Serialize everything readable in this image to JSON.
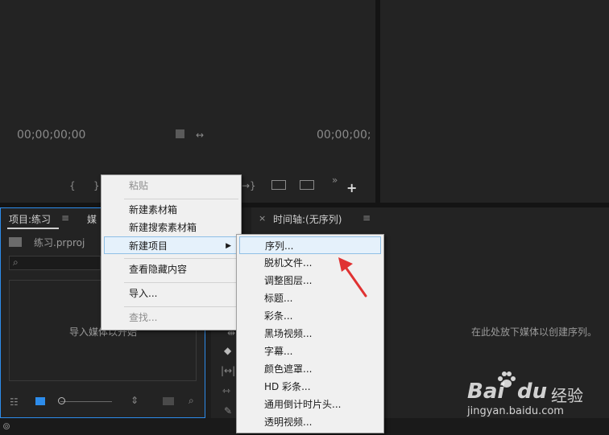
{
  "source_monitor": {
    "timecode": "00;00;00;00"
  },
  "program_monitor": {
    "timecode": "00;00;00;"
  },
  "project_panel": {
    "tab_label": "项目:练习",
    "tab2_label": "媒",
    "file_name": "练习.prproj",
    "empty_text": "导入媒体以开始"
  },
  "timeline_panel": {
    "tab_label": "时间轴:(无序列)",
    "empty_text": "在此处放下媒体以创建序列。"
  },
  "context_menu": {
    "paste": "粘贴",
    "new_bin": "新建素材箱",
    "new_search_bin": "新建搜索素材箱",
    "new_item": "新建项目",
    "view_hidden": "查看隐藏内容",
    "import": "导入...",
    "find": "查找..."
  },
  "submenu": {
    "items": [
      "序列...",
      "脱机文件...",
      "调整图层...",
      "标题...",
      "彩条...",
      "黑场视频...",
      "字幕...",
      "颜色遮罩...",
      "HD 彩条...",
      "通用倒计时片头...",
      "透明视频..."
    ]
  },
  "watermark": {
    "brand": "Bai",
    "brand2": "du",
    "jingyan": "经验",
    "url": "jingyan.baidu.com"
  },
  "colors": {
    "accent_blue": "#2d8ceb",
    "arrow_red": "#e03232",
    "menu_bg": "#f0f0f0"
  }
}
